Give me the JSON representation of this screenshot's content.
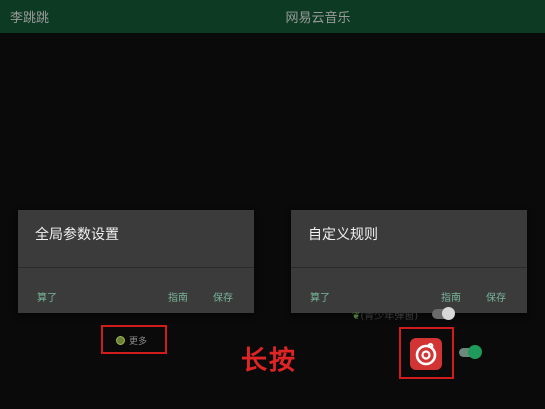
{
  "titlebar": {
    "left": "李跳跳",
    "center": "网易云音乐"
  },
  "dialogs": [
    {
      "title": "全局参数设置",
      "buttons": {
        "cancel": "算了",
        "guide": "指南",
        "save": "保存"
      }
    },
    {
      "title": "自定义规则",
      "buttons": {
        "cancel": "算了",
        "guide": "指南",
        "save": "保存"
      }
    }
  ],
  "more": {
    "label": "更多"
  },
  "annotation": {
    "longpress": "长按"
  },
  "youth_mode": {
    "label": "(青少年弹窗)"
  },
  "app_icon": {
    "name": "netease-cloud-music-icon"
  },
  "colors": {
    "titlebar_bg": "#0c3a22",
    "accent_text": "#78b49a",
    "highlight_red": "#d01c1c",
    "toggle_green": "#1f9a5a"
  }
}
